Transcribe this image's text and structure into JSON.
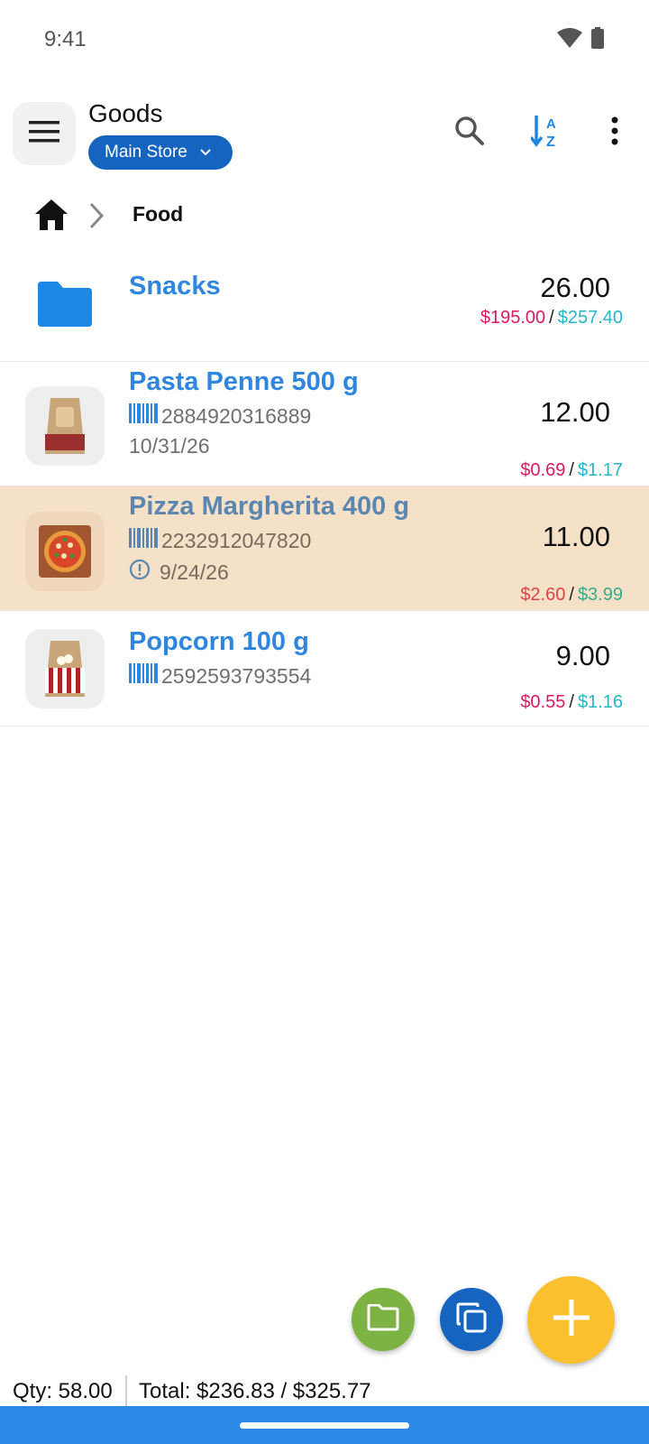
{
  "status_bar": {
    "time": "9:41",
    "icons": [
      "wifi-icon",
      "battery-icon"
    ]
  },
  "app_bar": {
    "title": "Goods",
    "store_selector": "Main Store",
    "actions": [
      "search-icon",
      "sort-az-icon",
      "more-vert-icon"
    ]
  },
  "breadcrumb": {
    "home": "home-icon",
    "current": "Food"
  },
  "items": [
    {
      "type": "folder",
      "name": "Snacks",
      "quantity": "26.00",
      "cost": "$195.00",
      "price": "$257.40"
    },
    {
      "type": "product",
      "name": "Pasta Penne 500 g",
      "barcode": "2884920316889",
      "date": "10/31/26",
      "quantity": "12.00",
      "cost": "$0.69",
      "price": "$1.17"
    },
    {
      "type": "product",
      "name": "Pizza Margherita 400 g",
      "barcode": "2232912047820",
      "date": "9/24/26",
      "date_warning": true,
      "highlighted": true,
      "quantity": "11.00",
      "cost": "$2.60",
      "price": "$3.99"
    },
    {
      "type": "product",
      "name": "Popcorn 100 g",
      "barcode": "2592593793554",
      "quantity": "9.00",
      "cost": "$0.55",
      "price": "$1.16"
    }
  ],
  "price_separator": "/",
  "fabs": [
    "folder-icon",
    "copy-icon",
    "add-icon"
  ],
  "footer": {
    "qty": "Qty: 58.00",
    "total": "Total: $236.83 / $325.77"
  },
  "colors": {
    "accent": "#2e86de",
    "chip": "#1565c0",
    "cost": "#d81b60",
    "sale": "#26b5c9",
    "highlight_row": "#f5e0c8",
    "fab_folder": "#7cb342",
    "fab_copy": "#1565c0",
    "fab_add": "#fbc02d",
    "nav_bar": "#2b88e4"
  }
}
